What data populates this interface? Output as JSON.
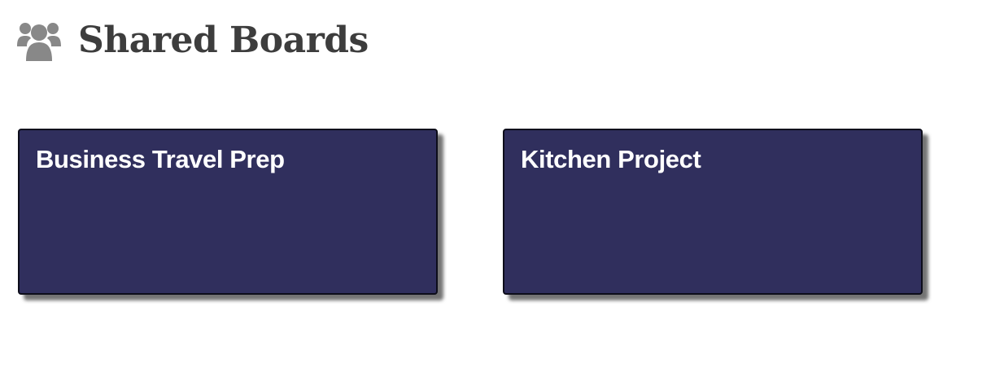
{
  "header": {
    "icon": "users-group-icon",
    "title": "Shared Boards"
  },
  "colors": {
    "title_text": "#3d3d3d",
    "icon": "#888888",
    "board_background": "#302f5d",
    "board_text": "#ffffff"
  },
  "boards": [
    {
      "title": "Business Travel Prep"
    },
    {
      "title": "Kitchen Project"
    }
  ]
}
